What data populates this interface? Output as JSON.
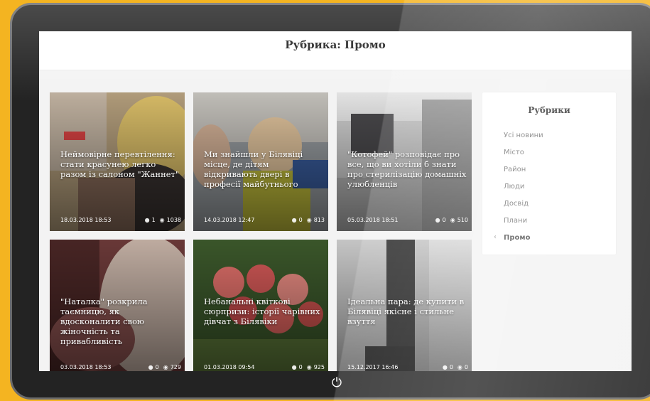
{
  "header": {
    "title": "Рубрика: Промо"
  },
  "cards": [
    {
      "title": "Неймовірне перевтілення: стати красунею легко разом із салоном \"Жаннет\"",
      "date": "18.03.2018 18:53",
      "comments": "1",
      "views": "1038"
    },
    {
      "title": "Ми знайшли у Білявіці місце, де дітям відкривають двері в професії майбутнього",
      "date": "14.03.2018 12:47",
      "comments": "0",
      "views": "813"
    },
    {
      "title": "\"Котофей\" розповідає про все, що ви хотіли б знати про стерилізацію домашніх улюбленців",
      "date": "05.03.2018 18:51",
      "comments": "0",
      "views": "510"
    },
    {
      "title": "\"Наталка\" розкрила таємницю, як вдосконалити свою жіночність та привабливість",
      "date": "03.03.2018 18:53",
      "comments": "0",
      "views": "729"
    },
    {
      "title": "Небанальні квіткові сюрпризи: історії чарівних дівчат з Білявіки",
      "date": "01.03.2018 09:54",
      "comments": "0",
      "views": "925"
    },
    {
      "title": "Ідеальна пара: де купити в Білявіці якісне і стильне взуття",
      "date": "15.12.2017 16:46",
      "comments": "0",
      "views": "0"
    }
  ],
  "sidebar": {
    "title": "Рубрики",
    "items": [
      "Усі новини",
      "Місто",
      "Район",
      "Люди",
      "Досвід",
      "Плани",
      "Промо"
    ],
    "active": "Промо"
  },
  "icons": {
    "comments": "comment-icon",
    "views": "eye-icon",
    "power": "power-icon"
  },
  "colors": {
    "frame": "#f4b421",
    "tablet": "#232323",
    "screen": "#f3f3f3"
  }
}
